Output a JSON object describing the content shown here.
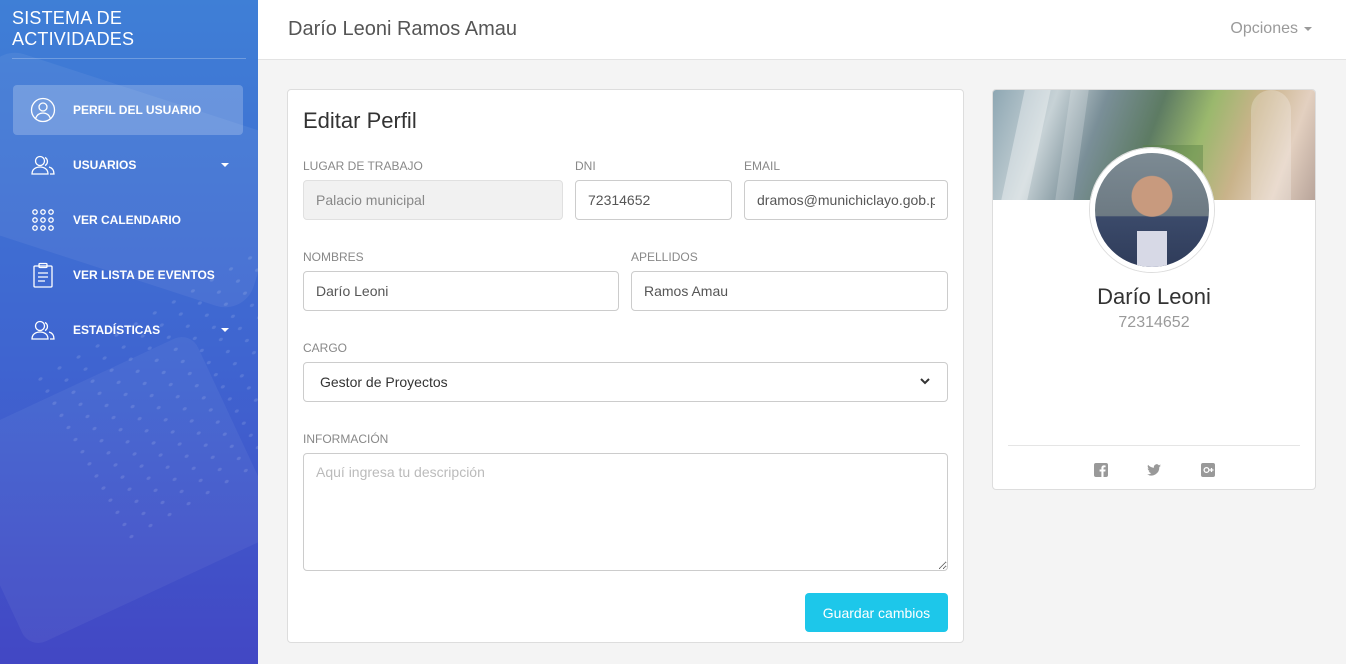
{
  "sidebar": {
    "brand": "SISTEMA DE ACTIVIDADES",
    "items": [
      {
        "label": "PERFIL DEL USUARIO",
        "icon": "user-circle-icon"
      },
      {
        "label": "USUARIOS",
        "icon": "users-icon"
      },
      {
        "label": "VER CALENDARIO",
        "icon": "grid-dots-icon"
      },
      {
        "label": "VER LISTA DE EVENTOS",
        "icon": "clipboard-icon"
      },
      {
        "label": "ESTADÍSTICAS",
        "icon": "users-icon"
      }
    ]
  },
  "header": {
    "title": "Darío Leoni Ramos Amau",
    "options_label": "Opciones"
  },
  "edit_profile": {
    "title": "Editar Perfil",
    "workplace_label": "LUGAR DE TRABAJO",
    "workplace_value": "Palacio municipal",
    "dni_label": "DNI",
    "dni_value": "72314652",
    "email_label": "EMAIL",
    "email_value": "dramos@munichiclayo.gob.pe",
    "names_label": "NOMBRES",
    "names_value": "Darío Leoni",
    "surnames_label": "APELLIDOS",
    "surnames_value": "Ramos Amau",
    "role_label": "CARGO",
    "role_value": "Gestor de Proyectos",
    "info_label": "INFORMACIÓN",
    "info_placeholder": "Aquí ingresa tu descripción",
    "save_label": "Guardar cambios"
  },
  "profile_card": {
    "name": "Darío Leoni",
    "dni": "72314652",
    "social": [
      "facebook-icon",
      "twitter-icon",
      "google-plus-icon"
    ]
  },
  "colors": {
    "accent": "#1dc7ea",
    "sidebar_top": "#3f7fd6",
    "sidebar_bottom": "#4247c4"
  }
}
